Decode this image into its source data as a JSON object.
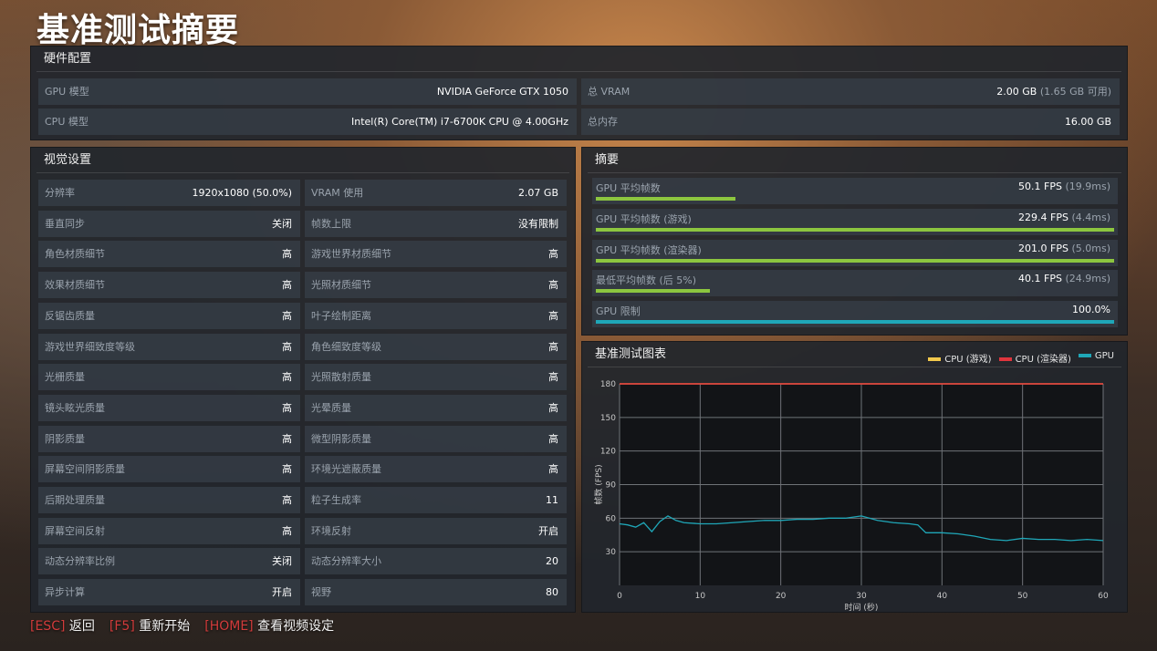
{
  "page_title": "基准测试摘要",
  "hardware": {
    "heading": "硬件配置",
    "rows": [
      {
        "label": "GPU 模型",
        "value": "NVIDIA GeForce GTX 1050",
        "extra": ""
      },
      {
        "label": "总 VRAM",
        "value": "2.00 GB",
        "extra": "(1.65 GB 可用)"
      },
      {
        "label": "CPU 模型",
        "value": "Intel(R) Core(TM) i7-6700K CPU @ 4.00GHz",
        "extra": ""
      },
      {
        "label": "总内存",
        "value": "16.00 GB",
        "extra": ""
      }
    ]
  },
  "visual": {
    "heading": "视觉设置",
    "rows": [
      {
        "label": "分辨率",
        "value": "1920x1080 (50.0%)"
      },
      {
        "label": "VRAM 使用",
        "value": "2.07 GB"
      },
      {
        "label": "垂直同步",
        "value": "关闭"
      },
      {
        "label": "帧数上限",
        "value": "没有限制"
      },
      {
        "label": "角色材质细节",
        "value": "高"
      },
      {
        "label": "游戏世界材质细节",
        "value": "高"
      },
      {
        "label": "效果材质细节",
        "value": "高"
      },
      {
        "label": "光照材质细节",
        "value": "高"
      },
      {
        "label": "反锯齿质量",
        "value": "高"
      },
      {
        "label": "叶子绘制距离",
        "value": "高"
      },
      {
        "label": "游戏世界细致度等级",
        "value": "高"
      },
      {
        "label": "角色细致度等级",
        "value": "高"
      },
      {
        "label": "光栅质量",
        "value": "高"
      },
      {
        "label": "光照散射质量",
        "value": "高"
      },
      {
        "label": "镜头眩光质量",
        "value": "高"
      },
      {
        "label": "光晕质量",
        "value": "高"
      },
      {
        "label": "阴影质量",
        "value": "高"
      },
      {
        "label": "微型阴影质量",
        "value": "高"
      },
      {
        "label": "屏幕空间阴影质量",
        "value": "高"
      },
      {
        "label": "环境光遮蔽质量",
        "value": "高"
      },
      {
        "label": "后期处理质量",
        "value": "高"
      },
      {
        "label": "粒子生成率",
        "value": "11"
      },
      {
        "label": "屏幕空间反射",
        "value": "高"
      },
      {
        "label": "环境反射",
        "value": "开启"
      },
      {
        "label": "动态分辨率比例",
        "value": "关闭"
      },
      {
        "label": "动态分辨率大小",
        "value": "20"
      },
      {
        "label": "异步计算",
        "value": "开启"
      },
      {
        "label": "视野",
        "value": "80"
      }
    ]
  },
  "summary": {
    "heading": "摘要",
    "rows": [
      {
        "label": "GPU 平均帧数",
        "value": "50.1 FPS",
        "extra": "(19.9ms)",
        "fill": 0.27,
        "color": "#8cc63f"
      },
      {
        "label": "GPU 平均帧数 (游戏)",
        "value": "229.4 FPS",
        "extra": "(4.4ms)",
        "fill": 1.0,
        "color": "#8cc63f"
      },
      {
        "label": "GPU 平均帧数 (渲染器)",
        "value": "201.0 FPS",
        "extra": "(5.0ms)",
        "fill": 1.0,
        "color": "#8cc63f"
      },
      {
        "label": "最低平均帧数 (后 5%)",
        "value": "40.1 FPS",
        "extra": "(24.9ms)",
        "fill": 0.22,
        "color": "#8cc63f"
      },
      {
        "label": "GPU 限制",
        "value": "100.0%",
        "extra": "",
        "fill": 1.0,
        "color": "#1fa7b8"
      }
    ]
  },
  "chart_panel": {
    "heading": "基准测试图表",
    "legend": [
      {
        "name": "CPU (游戏)",
        "color": "#f2c94c"
      },
      {
        "name": "CPU (渲染器)",
        "color": "#e0353d"
      },
      {
        "name": "GPU",
        "color": "#1fa7b8"
      }
    ]
  },
  "chart_data": {
    "type": "line",
    "xlabel": "时间 (秒)",
    "ylabel": "帧数 (FPS)",
    "xlim": [
      0,
      60
    ],
    "ylim": [
      0,
      180
    ],
    "x_ticks": [
      0,
      10,
      20,
      30,
      40,
      50,
      60
    ],
    "y_ticks": [
      30,
      60,
      90,
      120,
      150,
      180
    ],
    "grid": true,
    "series": [
      {
        "name": "CPU (游戏)",
        "x": [
          0,
          60
        ],
        "y": [
          180,
          180
        ]
      },
      {
        "name": "CPU (渲染器)",
        "x": [
          0,
          60
        ],
        "y": [
          180,
          180
        ]
      },
      {
        "name": "GPU",
        "x": [
          0,
          1,
          2,
          3,
          4,
          5,
          6,
          7,
          8,
          10,
          12,
          14,
          16,
          18,
          20,
          22,
          24,
          26,
          28,
          30,
          32,
          34,
          36,
          37,
          38,
          40,
          42,
          44,
          46,
          48,
          50,
          52,
          54,
          56,
          58,
          60
        ],
        "y": [
          55,
          54,
          52,
          56,
          48,
          57,
          62,
          58,
          56,
          55,
          55,
          56,
          57,
          58,
          58,
          59,
          59,
          60,
          60,
          62,
          58,
          56,
          55,
          54,
          47,
          47,
          46,
          44,
          41,
          40,
          42,
          41,
          41,
          40,
          41,
          40
        ]
      }
    ]
  },
  "footer": [
    {
      "key": "[ESC]",
      "label": "返回"
    },
    {
      "key": "[F5]",
      "label": "重新开始"
    },
    {
      "key": "[HOME]",
      "label": "查看视频设定"
    }
  ]
}
